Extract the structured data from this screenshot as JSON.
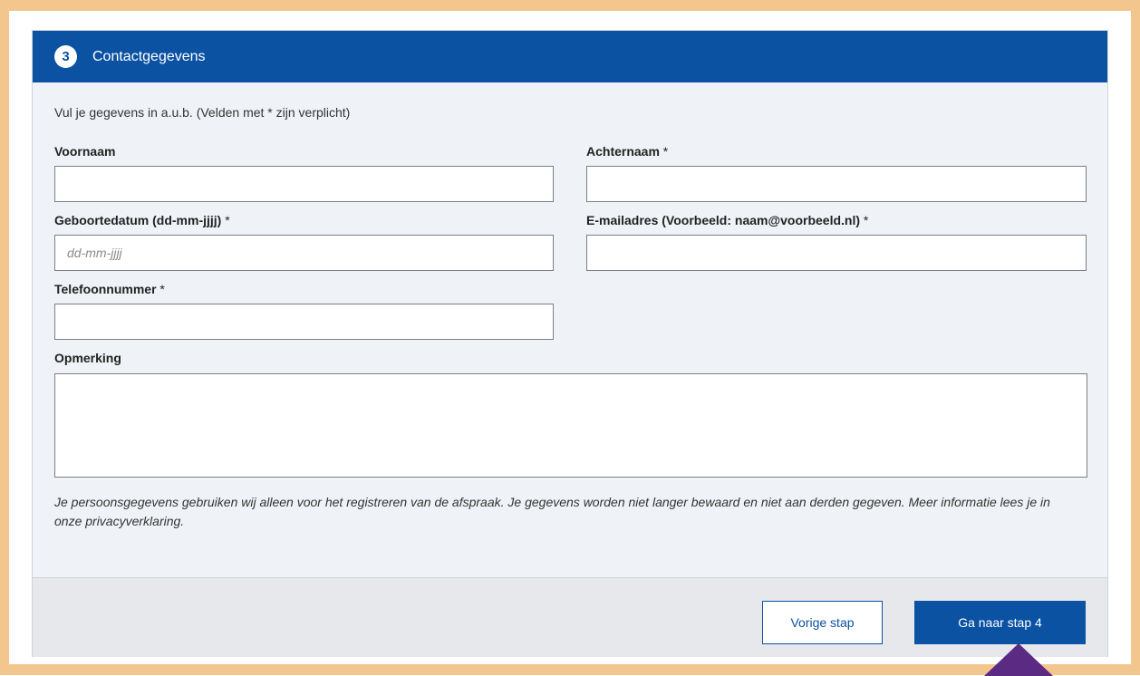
{
  "header": {
    "step_number": "3",
    "title": "Contactgegevens"
  },
  "intro": "Vul je gegevens in a.u.b. (Velden met * zijn verplicht)",
  "fields": {
    "voornaam": {
      "label": "Voornaam",
      "value": ""
    },
    "achternaam": {
      "label": "Achternaam",
      "required": " *",
      "value": ""
    },
    "geboortedatum": {
      "label": "Geboortedatum (dd-mm-jjjj)",
      "required": " *",
      "placeholder": "dd-mm-jjjj",
      "value": ""
    },
    "email": {
      "label": "E-mailadres (Voorbeeld: naam@voorbeeld.nl)",
      "required": " *",
      "value": ""
    },
    "telefoon": {
      "label": "Telefoonnummer",
      "required": " *",
      "value": ""
    },
    "opmerking": {
      "label": "Opmerking",
      "value": ""
    }
  },
  "privacy_text": "Je persoonsgegevens gebruiken wij alleen voor het registreren van de afspraak. Je gegevens worden niet langer bewaard en niet aan derden gegeven. Meer informatie lees je in onze privacyverklaring.",
  "buttons": {
    "previous": "Vorige stap",
    "next": "Ga naar stap 4"
  },
  "colors": {
    "primary": "#0b52a3",
    "frame": "#f3c68e",
    "pointer": "#5b2a82",
    "panel": "#eff3f7"
  }
}
